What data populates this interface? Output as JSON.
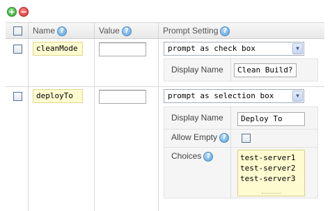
{
  "toolbar": {
    "add_symbol": "+",
    "remove_symbol": "−"
  },
  "header": {
    "name_label": "Name",
    "value_label": "Value",
    "prompt_label": "Prompt Setting",
    "help_symbol": "?"
  },
  "rows": [
    {
      "name": "cleanMode",
      "value": "",
      "prompt": "prompt as check box",
      "display_name_label": "Display Name",
      "display_name": "Clean Build?"
    },
    {
      "name": "deployTo",
      "value": "",
      "prompt": "prompt as selection box",
      "display_name_label": "Display Name",
      "display_name": "Deploy To",
      "allow_empty_label": "Allow Empty",
      "allow_empty": false,
      "choices_label": "Choices",
      "choices": [
        "test-server1",
        "test-server2",
        "test-server3"
      ]
    }
  ],
  "icons": {
    "arrow": "▼"
  }
}
